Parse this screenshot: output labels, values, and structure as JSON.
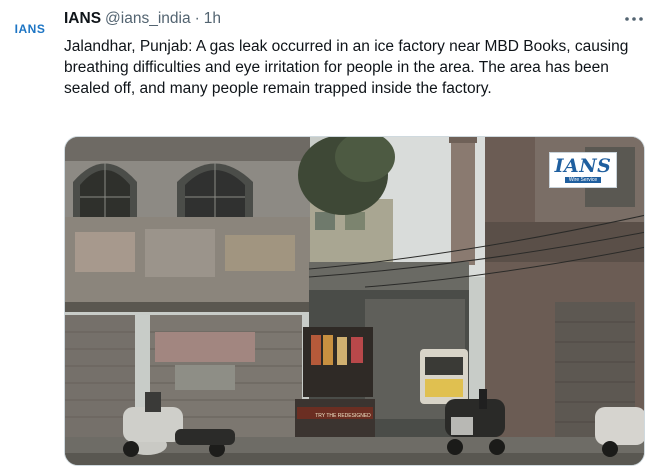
{
  "account": {
    "avatar_text": "IANS",
    "name": "IANS",
    "handle": "@ians_india",
    "separator": "·",
    "time": "1h",
    "more_icon": "more-dots-icon"
  },
  "tweet": {
    "text": "Jalandhar, Punjab: A gas leak occurred in an ice factory near MBD Books, causing breathing difficulties and eye irritation for people in the area. The area has been sealed off, and many people remain trapped inside the factory."
  },
  "media": {
    "watermark_main": "IANS",
    "watermark_sub": "Wire Service",
    "shop_sign": "TRY THE REDESIGNED"
  },
  "colors": {
    "brand_blue": "#1d75c4",
    "text": "#0f1419",
    "muted": "#536471",
    "border": "#cfd9de"
  }
}
